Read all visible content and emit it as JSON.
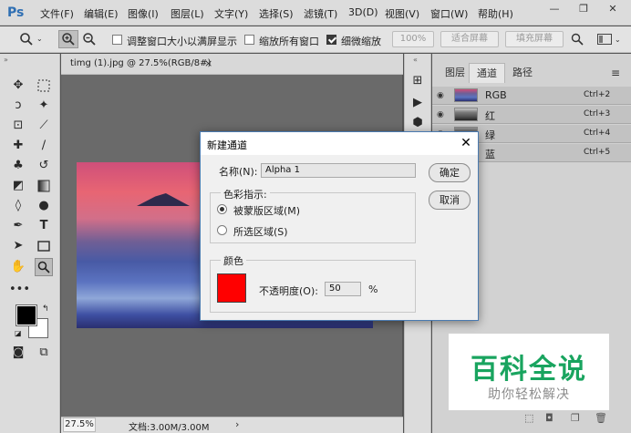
{
  "app": {
    "logo": "Ps"
  },
  "menubar": {
    "items": [
      "文件(F)",
      "编辑(E)",
      "图像(I)",
      "图层(L)",
      "文字(Y)",
      "选择(S)",
      "滤镜(T)",
      "3D(D)",
      "视图(V)",
      "窗口(W)",
      "帮助(H)"
    ]
  },
  "window_controls": {
    "minimize": "—",
    "restore": "❐",
    "close": "✕"
  },
  "options_bar": {
    "resize_windows_label": "调整窗口大小以满屏显示",
    "resize_windows_checked": false,
    "zoom_all_label": "缩放所有窗口",
    "zoom_all_checked": false,
    "scrubby_label": "细微缩放",
    "scrubby_checked": true,
    "zoom_pct_button": "100%",
    "fit_screen_button": "适合屏幕",
    "fill_screen_button": "填充屏幕"
  },
  "document": {
    "tab_title": "timg (1).jpg @ 27.5%(RGB/8#)",
    "tab_close": "×",
    "zoom": "27.5%",
    "doc_size": "文档:3.00M/3.00M",
    "status_arrow": "›"
  },
  "panel": {
    "tabs": [
      "图层",
      "通道",
      "路径"
    ],
    "active_tab": 1,
    "channels": [
      {
        "name": "RGB",
        "shortcut": "Ctrl+2"
      },
      {
        "name": "红",
        "shortcut": "Ctrl+3"
      },
      {
        "name": "绿",
        "shortcut": "Ctrl+4"
      },
      {
        "name": "蓝",
        "shortcut": "Ctrl+5"
      }
    ]
  },
  "dialog": {
    "title": "新建通道",
    "close": "✕",
    "name_label": "名称(N):",
    "name_value": "Alpha 1",
    "ok_button": "确定",
    "cancel_button": "取消",
    "color_indicates_group": "色彩指示:",
    "radio_masked": "被蒙版区域(M)",
    "radio_selected": "所选区域(S)",
    "color_group": "颜色",
    "swatch_color": "#ff0000",
    "opacity_label": "不透明度(O):",
    "opacity_value": "50",
    "opacity_unit": "%"
  },
  "watermark": {
    "title": "百科全说",
    "subtitle": "助你轻松解决"
  }
}
